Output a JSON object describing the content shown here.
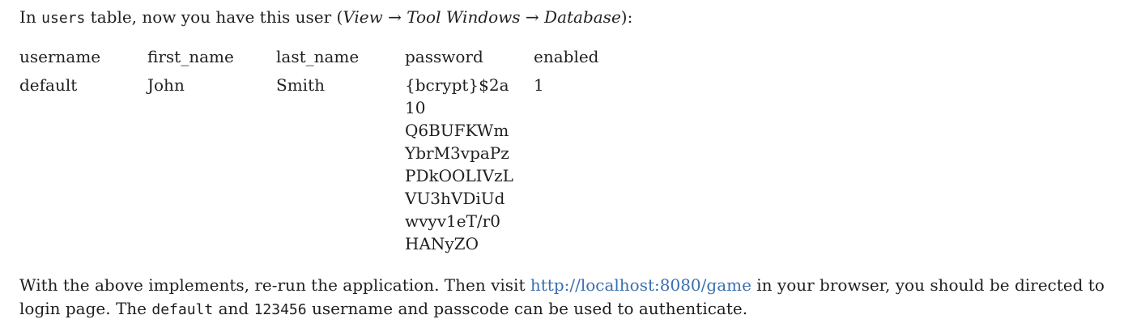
{
  "intro": {
    "prefix": "In ",
    "table_name": "users",
    "middle": " table, now you have this user (",
    "menu_path": "View → Tool Windows → Database",
    "suffix": "):"
  },
  "table": {
    "headers": [
      "username",
      "first_name",
      "last_name",
      "password",
      "enabled"
    ],
    "row": {
      "username": "default",
      "first_name": "John",
      "last_name": "Smith",
      "password_lines": [
        "{bcrypt}$2a",
        "10",
        "Q6BUFKWm",
        "YbrM3vpaPz",
        "PDkOOLIVzL",
        "VU3hVDiUd",
        "wvyv1eT/r0",
        "HANyZO"
      ],
      "enabled": "1"
    }
  },
  "outro": {
    "text1": "With the above implements, re-run the application. Then visit ",
    "link": "http://localhost:8080/game",
    "text2": " in your browser, you should be directed to login page. The ",
    "username_code": "default",
    "text3": " and ",
    "password_code": "123456",
    "text4": " username and passcode can be used to authenticate."
  }
}
